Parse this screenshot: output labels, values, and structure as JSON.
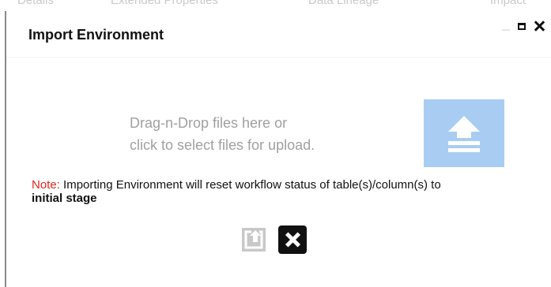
{
  "background_tabs": [
    "Details",
    "Extended Properties",
    "Data Lineage",
    "Impact"
  ],
  "dialog": {
    "title": "Import Environment",
    "controls": {
      "minimize": "minimize-icon",
      "maximize": "maximize-icon",
      "close": "close-icon"
    }
  },
  "dropzone": {
    "line1": "Drag-n-Drop files here or",
    "line2": "click to select files for upload.",
    "icon": "upload-icon",
    "icon_bg_color": "#a9cdf2"
  },
  "note": {
    "label": "Note:",
    "text": " Importing Environment will reset workflow status of table(s)/column(s) to ",
    "emphasis": "initial stage",
    "label_color": "#e0261b"
  },
  "actions": {
    "import_icon": "import-icon",
    "cancel_icon": "cancel-icon"
  }
}
